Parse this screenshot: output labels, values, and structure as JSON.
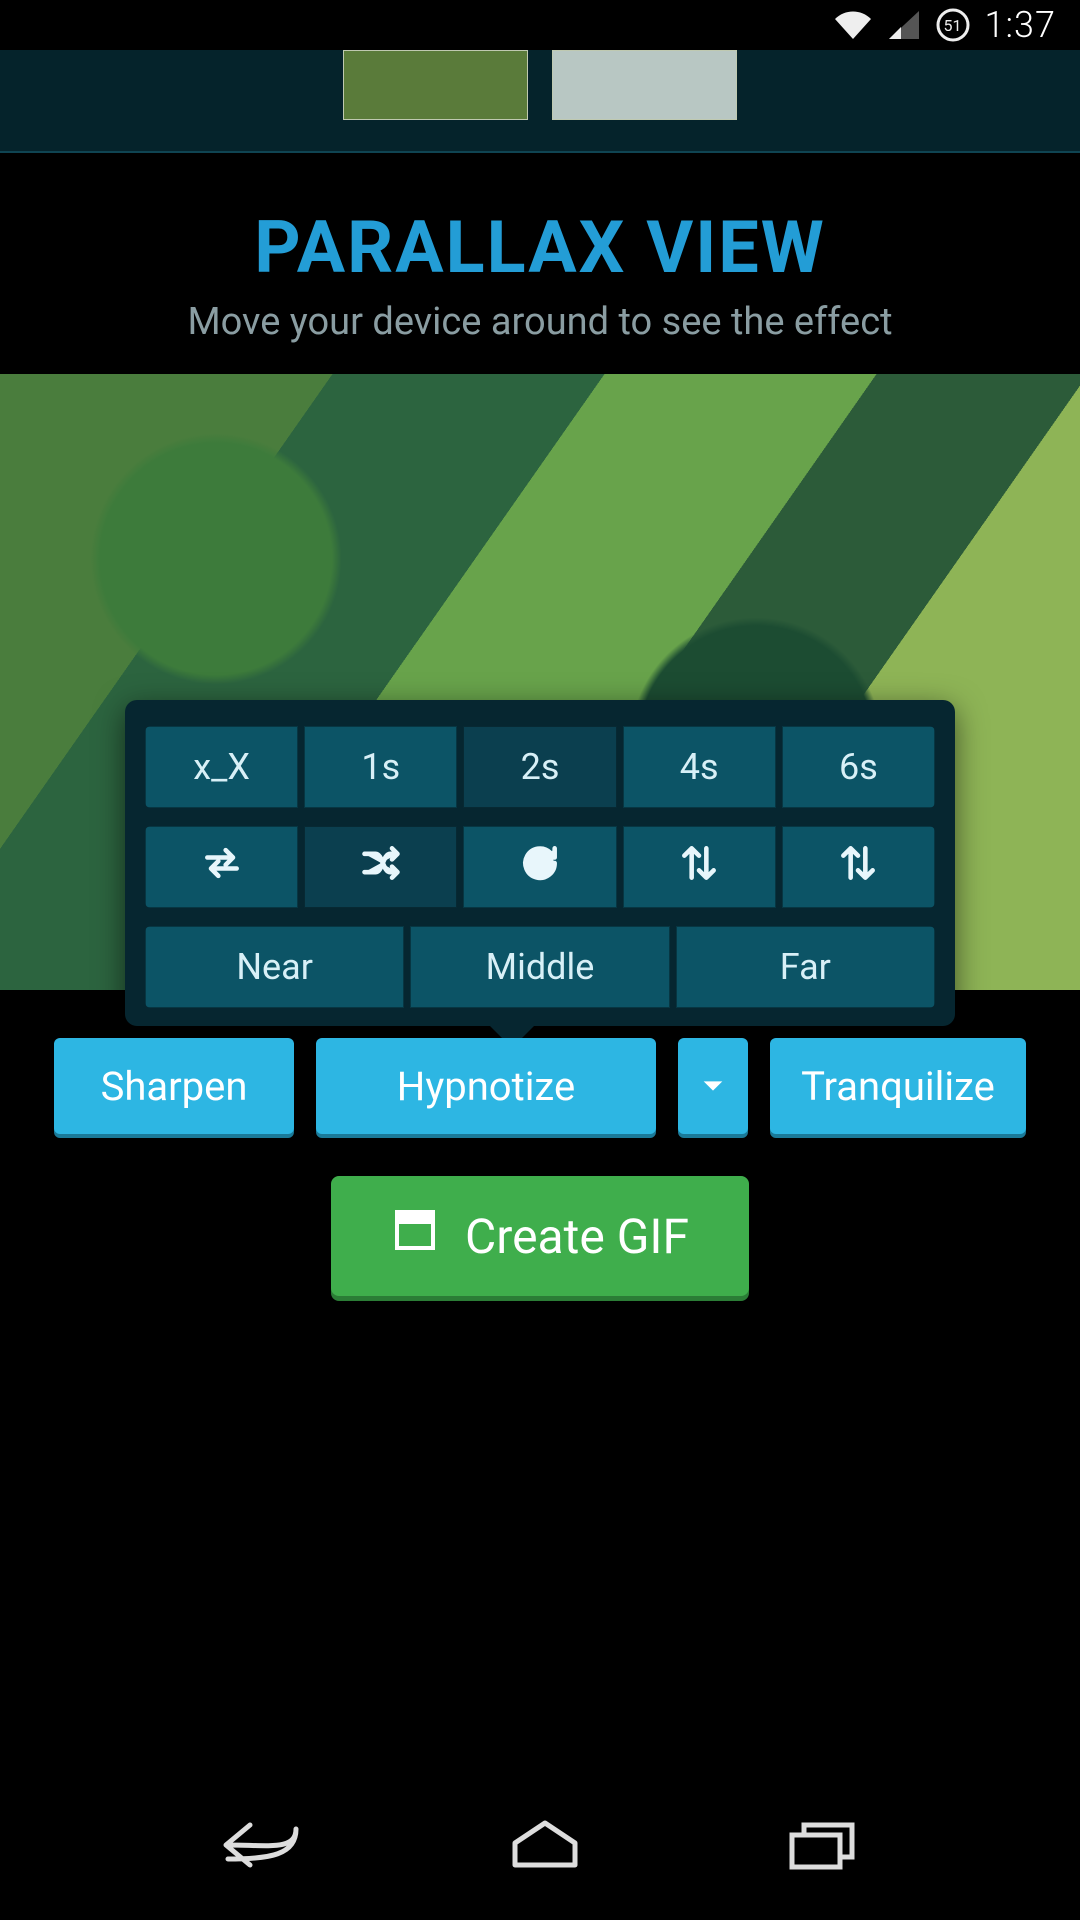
{
  "statusbar": {
    "battery_text": "51",
    "time": "1:37"
  },
  "header": {
    "title": "PARALLAX VIEW",
    "subtitle": "Move your device around to see the effect"
  },
  "popover": {
    "row1": {
      "options": [
        "x_X",
        "1s",
        "2s",
        "4s",
        "6s"
      ],
      "selected_index": 2
    },
    "row2": {
      "icon_names": [
        "swap-horizontal-icon",
        "shuffle-icon",
        "refresh-icon",
        "swap-vertical-icon",
        "sort-vertical-icon"
      ],
      "selected_index": 1
    },
    "row3": {
      "options": [
        "Near",
        "Middle",
        "Far"
      ],
      "selected_index": null
    }
  },
  "actions": {
    "sharpen": "Sharpen",
    "hypnotize": "Hypnotize",
    "tranquilize": "Tranquilize"
  },
  "create": {
    "label": "Create GIF"
  }
}
